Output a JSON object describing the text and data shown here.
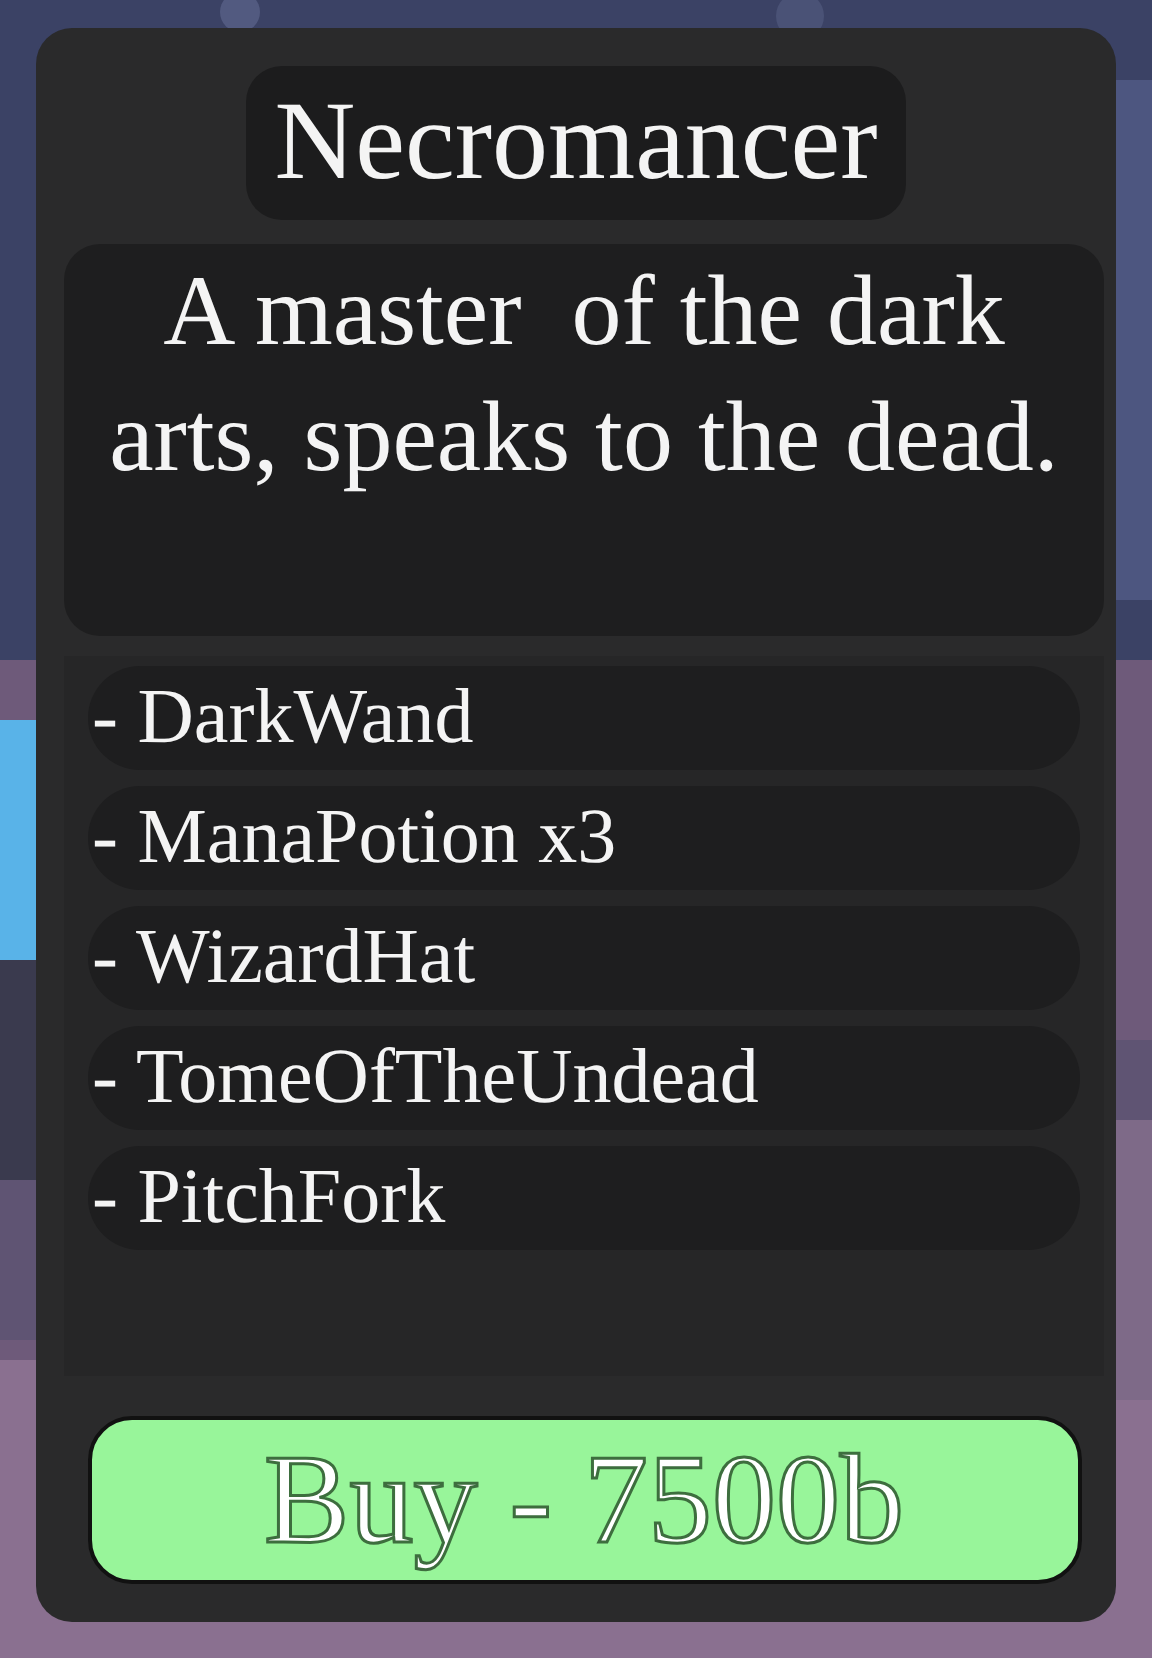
{
  "title": "Necromancer",
  "description": "A master  of the dark arts, speaks to the dead.",
  "items": [
    {
      "label": "- DarkWand"
    },
    {
      "label": "- ManaPotion x3"
    },
    {
      "label": "- WizardHat"
    },
    {
      "label": "- TomeOfTheUndead"
    },
    {
      "label": "- PitchFork"
    }
  ],
  "buy_button": "Buy - 7500b"
}
